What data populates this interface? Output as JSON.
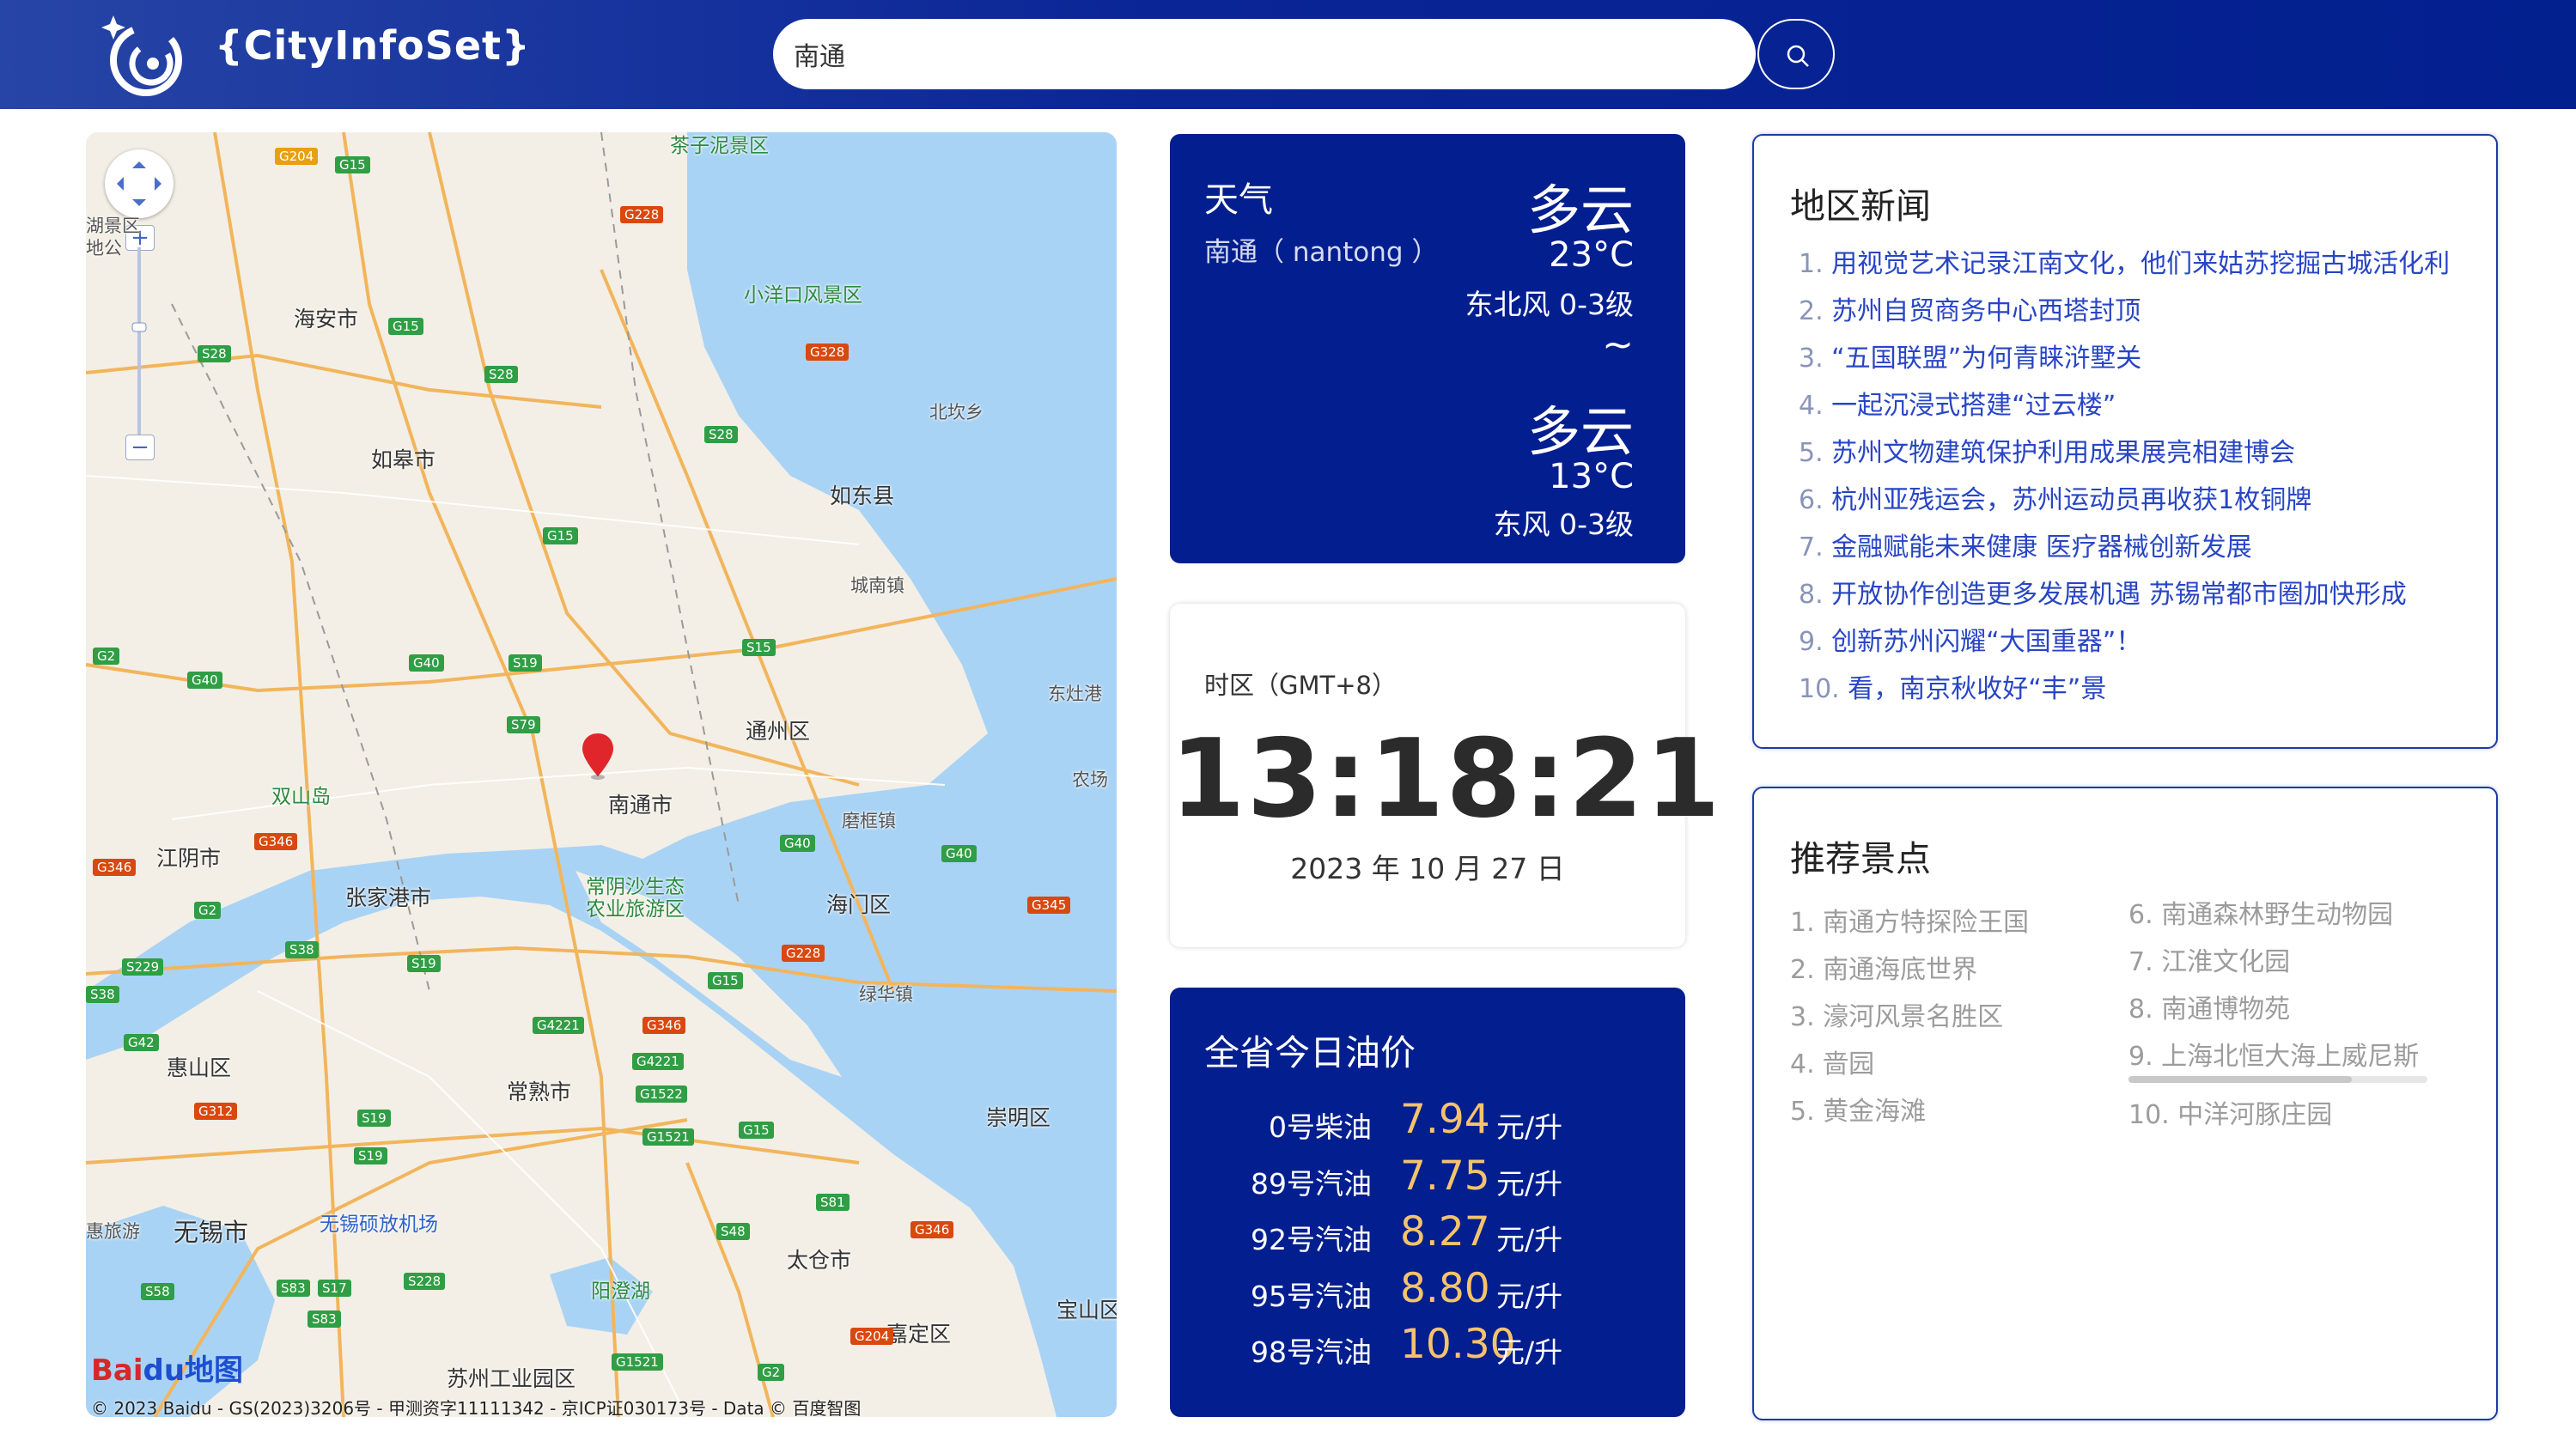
{
  "header": {
    "logo_text": "{CityInfoSet}",
    "search_value": "南通"
  },
  "map": {
    "places": {
      "haian": "海安市",
      "rugao": "如皋市",
      "rudong": "如东县",
      "tongzhou": "通州区",
      "nantong": "南通市",
      "jiangyin": "江阴市",
      "zhangjiagang": "张家港市",
      "haimen": "海门区",
      "changshu": "常熟市",
      "huishan": "惠山区",
      "wuxi": "无锡市",
      "taicang": "太仓市",
      "chongming": "崇明区",
      "jiading": "嘉定区",
      "suzhou_ind": "苏州工业园区",
      "beikan": "北坎乡",
      "chengnan": "城南镇",
      "mozhong": "磨框镇",
      "lvhua": "绿华镇",
      "dongzao": "东灶港",
      "nongchang": "农场",
      "baoshan": "宝山区",
      "lvyou": "惠旅游",
      "xiaoyangkou": "小洋口风景区",
      "chazilian": "茶子泥景区",
      "shuangshan": "双山岛",
      "changyin": "常阴沙生态\n农业旅游区",
      "yangchenghu": "阳澄湖",
      "airport": "无锡硕放机场",
      "left_edge": "湖景区\n地公"
    },
    "copyright": "© 2023 Baidu - GS(2023)3206号 - 甲测资字11111342 - 京ICP证030173号 - Data © 百度智图",
    "logo_bai": "Bai",
    "logo_du": "du地图"
  },
  "weather": {
    "title": "天气",
    "city": "南通（ nantong ）",
    "today_condition": "多云",
    "today_temp": "23°C",
    "today_wind": "东北风 0-3级",
    "separator": "~",
    "tomorrow_condition": "多云",
    "tomorrow_temp": "13°C",
    "tomorrow_wind": "东风 0-3级"
  },
  "clock": {
    "timezone": "时区（GMT+8）",
    "time": "13:18:21",
    "date": "2023 年 10 月 27 日"
  },
  "oil": {
    "title": "全省今日油价",
    "items": [
      {
        "name": "0号柴油",
        "price": "7.94",
        "unit": "元/升"
      },
      {
        "name": "89号汽油",
        "price": "7.75",
        "unit": "元/升"
      },
      {
        "name": "92号汽油",
        "price": "8.27",
        "unit": "元/升"
      },
      {
        "name": "95号汽油",
        "price": "8.80",
        "unit": "元/升"
      },
      {
        "name": "98号汽油",
        "price": "10.30",
        "unit": "元/升"
      }
    ]
  },
  "news": {
    "title": "地区新闻",
    "items": [
      {
        "num": "1.",
        "text": "用视觉艺术记录江南文化，他们来姑苏挖掘古城活化利"
      },
      {
        "num": "2.",
        "text": "苏州自贸商务中心西塔封顶"
      },
      {
        "num": "3.",
        "text": "“五国联盟”为何青睐浒墅关"
      },
      {
        "num": "4.",
        "text": "一起沉浸式搭建“过云楼”"
      },
      {
        "num": "5.",
        "text": "苏州文物建筑保护利用成果展亮相建博会"
      },
      {
        "num": "6.",
        "text": "杭州亚残运会，苏州运动员再收获1枚铜牌"
      },
      {
        "num": "7.",
        "text": "金融赋能未来健康 医疗器械创新发展"
      },
      {
        "num": "8.",
        "text": "开放协作创造更多发展机遇 苏锡常都市圈加快形成"
      },
      {
        "num": "9.",
        "text": "创新苏州闪耀“大国重器”！"
      },
      {
        "num": "10.",
        "text": "看，南京秋收好“丰”景"
      }
    ]
  },
  "spots": {
    "title": "推荐景点",
    "left": [
      "1. 南通方特探险王国",
      "2. 南通海底世界",
      "3. 濠河风景名胜区",
      "4. 啬园",
      "5. 黄金海滩"
    ],
    "right": [
      "6. 南通森林野生动物园",
      "7. 江淮文化园",
      "8. 南通博物苑",
      "9. 上海北恒大海上威尼斯",
      "10. 中洋河豚庄园"
    ]
  },
  "colors": {
    "header": "#03208f",
    "card_blue": "#031f8f",
    "price_gold": "#f5c36b",
    "news_link": "#2845c5",
    "panel_border": "#1f3aa6"
  }
}
